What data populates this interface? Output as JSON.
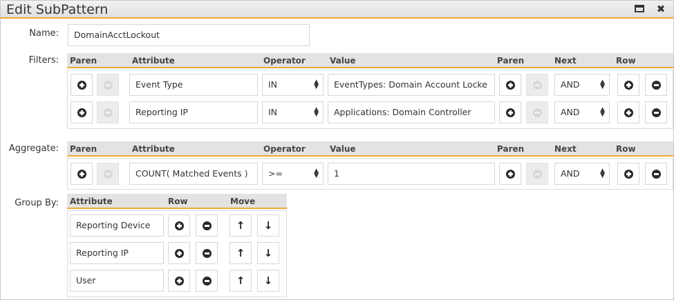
{
  "dialog": {
    "title": "Edit SubPattern",
    "close_glyph": "✖",
    "icons": {
      "maximize": "maximize-icon",
      "close": "close-icon"
    }
  },
  "name": {
    "label": "Name:",
    "value": "DomainAcctLockout"
  },
  "filters": {
    "label": "Filters:",
    "headers": {
      "paren_open": "Paren",
      "attribute": "Attribute",
      "operator": "Operator",
      "value": "Value",
      "paren_close": "Paren",
      "next": "Next",
      "row": "Row"
    },
    "rows": [
      {
        "attribute": "Event Type",
        "operator": "IN",
        "value": "EventTypes: Domain Account Locke",
        "next": "AND"
      },
      {
        "attribute": "Reporting IP",
        "operator": "IN",
        "value": "Applications: Domain Controller",
        "next": "AND"
      }
    ]
  },
  "aggregate": {
    "label": "Aggregate:",
    "headers": {
      "paren_open": "Paren",
      "attribute": "Attribute",
      "operator": "Operator",
      "value": "Value",
      "paren_close": "Paren",
      "next": "Next",
      "row": "Row"
    },
    "rows": [
      {
        "attribute": "COUNT( Matched Events )",
        "operator": ">=",
        "value": "1",
        "next": "AND"
      }
    ]
  },
  "group_by": {
    "label": "Group By:",
    "headers": {
      "attribute": "Attribute",
      "row": "Row",
      "move": "Move"
    },
    "rows": [
      {
        "attribute": "Reporting Device"
      },
      {
        "attribute": "Reporting IP"
      },
      {
        "attribute": "User"
      }
    ],
    "arrows": {
      "up": "↑",
      "down": "↓"
    }
  },
  "select_arrows": {
    "up": "▲",
    "down": "▼"
  }
}
